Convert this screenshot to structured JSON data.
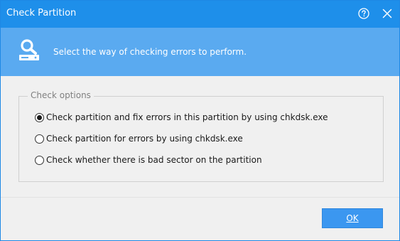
{
  "window": {
    "title": "Check Partition",
    "help_icon": "help-icon",
    "close_icon": "close-icon"
  },
  "banner": {
    "icon": "disk-search-icon",
    "text": "Select the way of checking errors to perform."
  },
  "check_options": {
    "legend": "Check options",
    "selected_index": 0,
    "options": [
      {
        "label": "Check partition and fix errors in this partition by using chkdsk.exe",
        "checked": true
      },
      {
        "label": "Check partition for errors by using chkdsk.exe",
        "checked": false
      },
      {
        "label": "Check whether there is bad sector on the partition",
        "checked": false
      }
    ]
  },
  "footer": {
    "ok_label": "OK"
  },
  "colors": {
    "titlebar": "#1e8fea",
    "banner": "#5aaaf0",
    "button": "#3b97f0",
    "body": "#f0f0f0"
  }
}
